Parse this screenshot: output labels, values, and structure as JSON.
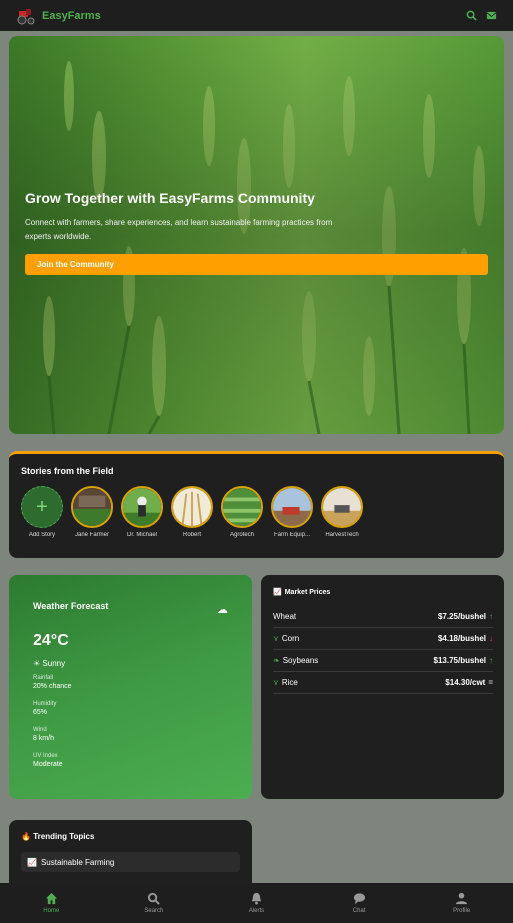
{
  "app": {
    "name": "EasyFarms"
  },
  "header": {
    "icons": [
      "search-icon",
      "mail-icon"
    ]
  },
  "hero": {
    "title": "Grow Together with EasyFarms Community",
    "text": "Connect with farmers, share experiences, and learn sustainable farming practices from experts worldwide.",
    "button": "Join the Community"
  },
  "stories": {
    "title": "Stories from the Field",
    "items": [
      {
        "label": "Add Story"
      },
      {
        "label": "Jane Farmer"
      },
      {
        "label": "Dr. Michael"
      },
      {
        "label": "Robert"
      },
      {
        "label": "Agrotech"
      },
      {
        "label": "Farm Equip..."
      },
      {
        "label": "HarvestTech"
      }
    ]
  },
  "weather": {
    "title": "Weather Forecast",
    "temp": "24°C",
    "condition": "Sunny",
    "stats": [
      {
        "key": "Rainfall",
        "value": "20% chance"
      },
      {
        "key": "Humidity",
        "value": "65%"
      },
      {
        "key": "Wind",
        "value": "8 km/h"
      },
      {
        "key": "UV Index",
        "value": "Moderate"
      }
    ]
  },
  "market": {
    "title": "Market Prices",
    "rows": [
      {
        "name": "Wheat",
        "price": "$7.25/bushel",
        "trend": "up"
      },
      {
        "name": "Corn",
        "price": "$4.18/bushel",
        "trend": "down"
      },
      {
        "name": "Soybeans",
        "price": "$13.75/bushel",
        "trend": "up"
      },
      {
        "name": "Rice",
        "price": "$14.30/cwt",
        "trend": "flat"
      }
    ]
  },
  "trending": {
    "title": "Trending Topics",
    "items": [
      {
        "label": "Sustainable Farming"
      }
    ]
  },
  "nav": [
    {
      "label": "Home",
      "active": true
    },
    {
      "label": "Search"
    },
    {
      "label": "Alerts"
    },
    {
      "label": "Chat"
    },
    {
      "label": "Profile"
    }
  ],
  "colors": {
    "accent": "#4caf50",
    "orange": "#ffa000",
    "dark": "#1f1f1f"
  }
}
